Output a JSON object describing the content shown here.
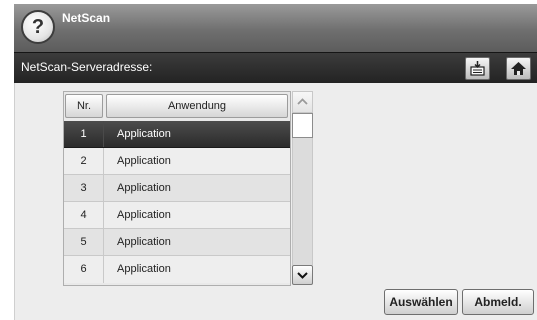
{
  "header": {
    "help_symbol": "?",
    "title": "NetScan"
  },
  "address_bar": {
    "label": "NetScan-Serveradresse:"
  },
  "toolbar": {
    "icons": [
      "edit-icon",
      "home-icon"
    ]
  },
  "table": {
    "columns": {
      "nr": "Nr.",
      "app": "Anwendung"
    },
    "rows": [
      {
        "nr": "1",
        "name": "Application",
        "selected": true
      },
      {
        "nr": "2",
        "name": "Application",
        "selected": false
      },
      {
        "nr": "3",
        "name": "Application",
        "selected": false
      },
      {
        "nr": "4",
        "name": "Application",
        "selected": false
      },
      {
        "nr": "5",
        "name": "Application",
        "selected": false
      },
      {
        "nr": "6",
        "name": "Application",
        "selected": false
      }
    ]
  },
  "buttons": {
    "select": "Auswählen",
    "logout": "Abmeld."
  },
  "colors": {
    "titlebar": "#6f6f6f",
    "addressbar": "#2b2b2b",
    "selected_row": "#333333"
  }
}
